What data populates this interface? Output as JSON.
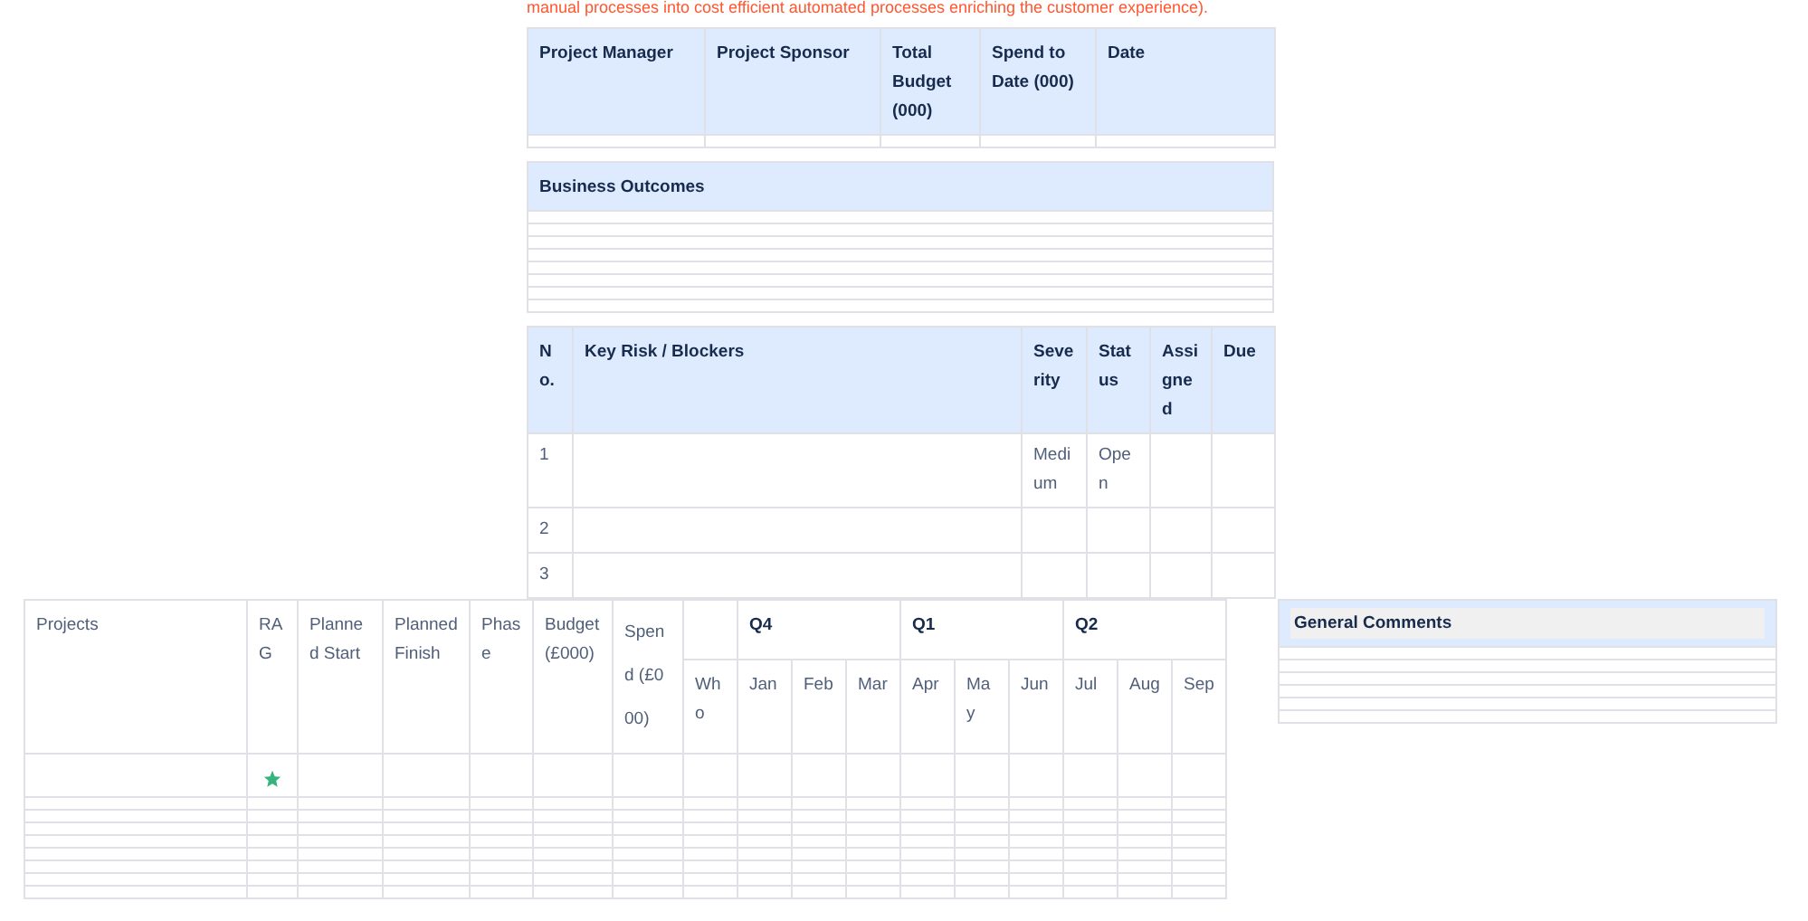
{
  "intro_text": "manual processes into cost efficient automated processes enriching the customer experience).",
  "summary_table": {
    "columns": [
      "Project Manager",
      "Project Sponsor",
      "Total Budget (000)",
      "Spend to Date (000)",
      "Date"
    ]
  },
  "outcomes_table": {
    "title": "Business Outcomes"
  },
  "risk_table": {
    "columns": [
      "No.",
      "Key Risk / Blockers",
      "Severity",
      "Status",
      "Assigned",
      "Due"
    ],
    "rows": [
      {
        "no": "1",
        "severity": "Medium",
        "status": "Open"
      },
      {
        "no": "2"
      },
      {
        "no": "3"
      }
    ]
  },
  "projects_table": {
    "columns": [
      "Projects",
      "RAG",
      "Planned Start",
      "Planned Finish",
      "Phase",
      "Budget (£000)",
      "Spend (£000)"
    ],
    "quarters": [
      "Q4",
      "Q1",
      "Q2"
    ],
    "sub_columns": [
      "Who",
      "Jan",
      "Feb",
      "Mar",
      "Apr",
      "May",
      "Jun",
      "Jul",
      "Aug",
      "Sep"
    ],
    "rows": [
      {
        "rag_star": true
      },
      {
        "rag_star": false
      },
      {
        "rag_star": false
      },
      {
        "rag_star": false
      },
      {
        "rag_star": false
      },
      {
        "rag_star": false
      },
      {
        "rag_star": false
      },
      {
        "rag_star": false
      },
      {
        "rag_star": false
      }
    ]
  },
  "comments_table": {
    "title": "General Comments"
  }
}
